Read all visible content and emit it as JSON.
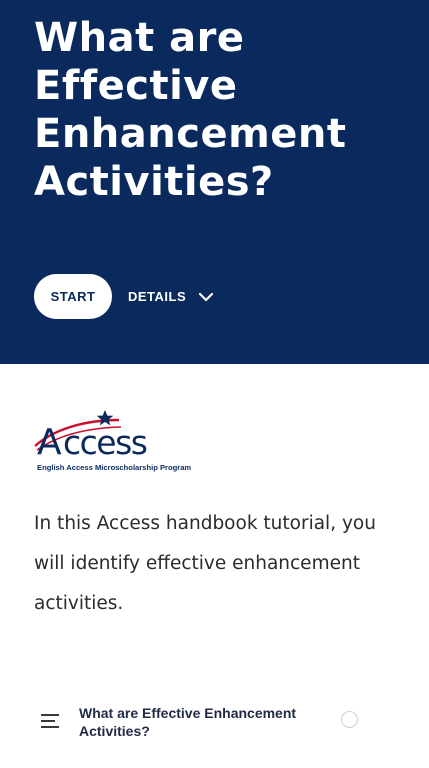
{
  "hero": {
    "title": "What are Effective Enhancement Activities?",
    "start_label": "START",
    "details_label": "DETAILS",
    "background": "#0a2a5e"
  },
  "logo": {
    "wordmark": "Access",
    "tagline": "English Access Microscholarship Program",
    "colors": {
      "navy": "#0a2a5e",
      "red": "#c8102e"
    }
  },
  "intro": {
    "text": "In this Access handbook tutorial, you will identify effective enhancement activities."
  },
  "lessons": [
    {
      "title": "What are Effective Enhancement Activities?",
      "icon": "text-lines-icon",
      "status": "not-started"
    }
  ]
}
